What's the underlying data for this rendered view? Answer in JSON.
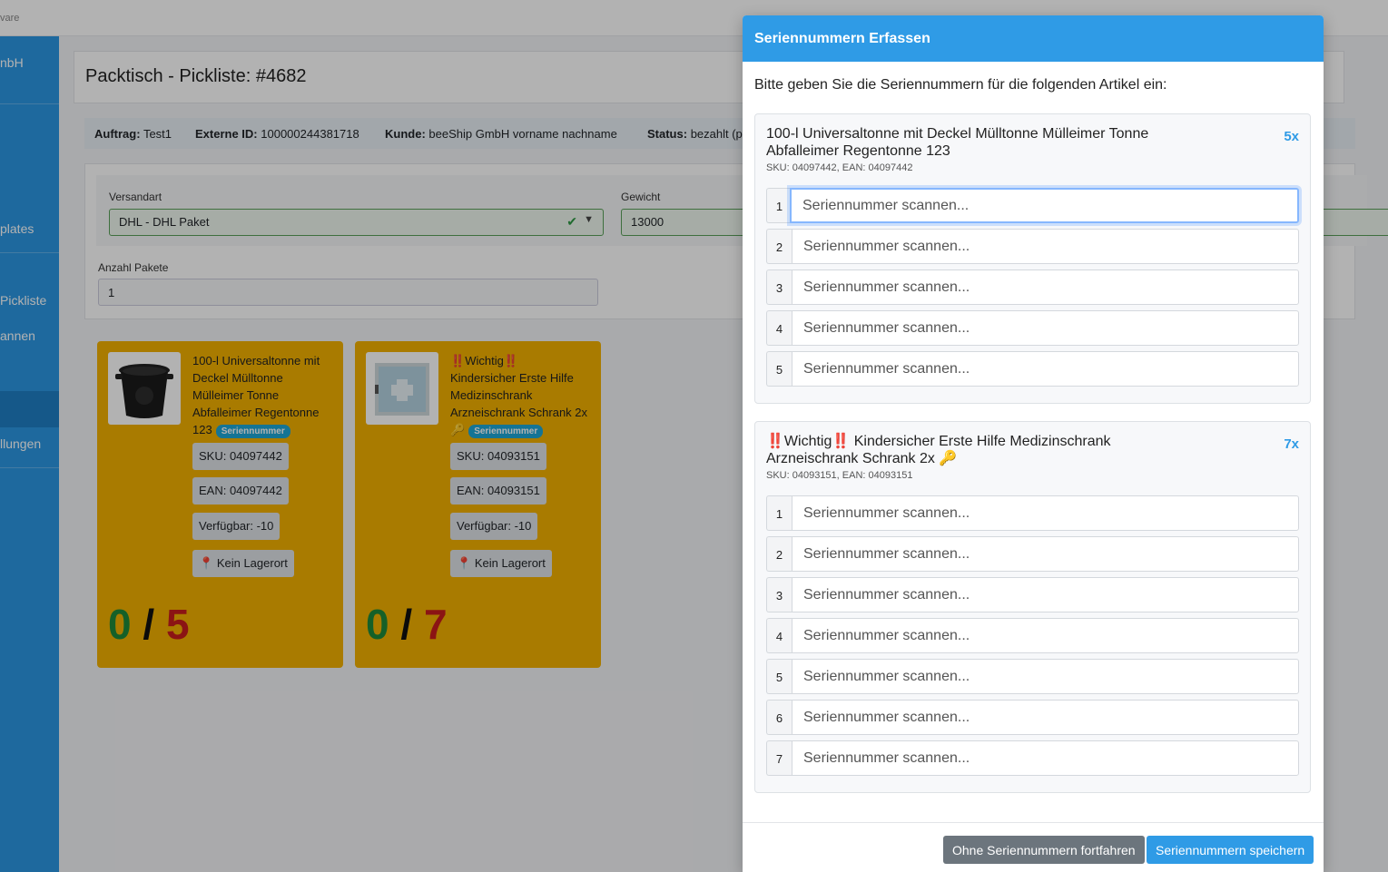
{
  "topbar": {
    "crumb": "vare"
  },
  "sidebar": {
    "brand": "nbH",
    "items": [
      {
        "label": "plates"
      },
      {
        "label": "Pickliste"
      },
      {
        "label": "annen"
      },
      {
        "label": "llungen"
      }
    ]
  },
  "page": {
    "title": "Packtisch - Pickliste: #4682",
    "info": {
      "auftrag_label": "Auftrag:",
      "auftrag_value": "Test1",
      "extid_label": "Externe ID:",
      "extid_value": "100000244381718",
      "kunde_label": "Kunde:",
      "kunde_value": "beeShip GmbH vorname nachname",
      "status_label": "Status:",
      "status_value": "bezahlt (p"
    },
    "form": {
      "versandart_label": "Versandart",
      "versandart_value": "DHL - DHL Paket",
      "gewicht_label": "Gewicht",
      "gewicht_value": "13000",
      "pakete_label": "Anzahl Pakete",
      "pakete_value": "1"
    }
  },
  "products": [
    {
      "title": "100-l Universaltonne mit Deckel Mülltonne Mülleimer Tonne Abfalleimer Regentonne 123",
      "badge": "Seriennummer",
      "sku": "SKU: 04097442",
      "ean": "EAN: 04097442",
      "available": "Verfügbar: -10",
      "location": "Kein Lagerort",
      "scanned": "0",
      "sep": "/",
      "total": "5"
    },
    {
      "title_prefix": "‼️",
      "title_word": "Wichtig",
      "title_suffix": "‼️",
      "title_rest": "Kindersicher Erste Hilfe Medizinschrank Arzneischrank Schrank 2x 🔑",
      "badge": "Seriennummer",
      "sku": "SKU: 04093151",
      "ean": "EAN: 04093151",
      "available": "Verfügbar: -10",
      "location": "Kein Lagerort",
      "scanned": "0",
      "sep": "/",
      "total": "7"
    }
  ],
  "modal": {
    "title": "Seriennummern Erfassen",
    "intro": "Bitte geben Sie die Seriennummern für die folgenden Artikel ein:",
    "placeholder": "Seriennummer scannen...",
    "groups": [
      {
        "title": "100-l Universaltonne mit Deckel Mülltonne Mülleimer Tonne Abfalleimer Regentonne 123",
        "sku_ean": "SKU: 04097442, EAN: 04097442",
        "qty": "5x",
        "rows": [
          "1",
          "2",
          "3",
          "4",
          "5"
        ]
      },
      {
        "title": "‼️Wichtig‼️ Kindersicher Erste Hilfe Medizinschrank Arzneischrank Schrank 2x 🔑",
        "sku_ean": "SKU: 04093151, EAN: 04093151",
        "qty": "7x",
        "rows": [
          "1",
          "2",
          "3",
          "4",
          "5",
          "6",
          "7"
        ]
      }
    ],
    "buttons": {
      "skip": "Ohne Seriennummern fortfahren",
      "save": "Seriennummern speichern"
    }
  },
  "colors": {
    "primary": "#2f9be6",
    "sidebar": "#2b97e3",
    "card": "#f2b100",
    "scanned": "#1f8a3a",
    "total": "#c81d1d",
    "secondary_btn": "#6c757d"
  }
}
